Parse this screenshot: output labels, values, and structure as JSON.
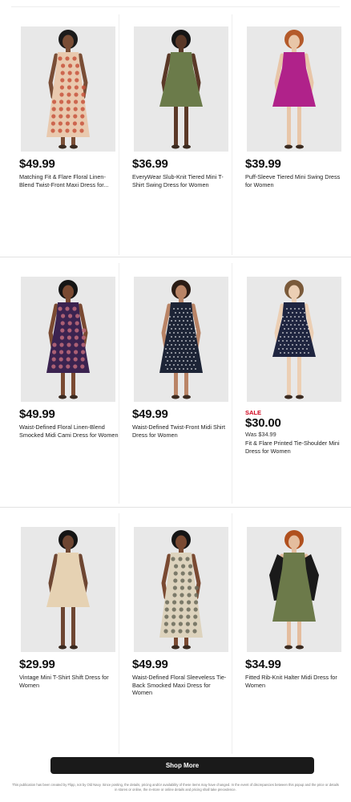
{
  "products": [
    {
      "price": "$49.99",
      "title": "Matching Fit & Flare Floral Linen-Blend Twist-Front Maxi Dress for...",
      "dress_color": "#e9c9ae",
      "accent": "#c8553d",
      "pattern": "floral",
      "skin": "#7a4e36",
      "hair": "#1b1b1b"
    },
    {
      "price": "$36.99",
      "title": "EveryWear Slub-Knit Tiered Mini T-Shirt Swing Dress for Women",
      "dress_color": "#6b7b4a",
      "accent": "#6b7b4a",
      "pattern": "solid",
      "skin": "#5a3827",
      "hair": "#151515"
    },
    {
      "price": "$39.99",
      "title": "Puff-Sleeve Tiered Mini Swing Dress for Women",
      "dress_color": "#b0228a",
      "accent": "#b0228a",
      "pattern": "solid",
      "skin": "#e8c6a8",
      "hair": "#b45a2a"
    },
    {
      "price": "$49.99",
      "title": "Waist-Defined Floral Linen-Blend Smocked Midi Cami Dress for Women",
      "dress_color": "#3b2350",
      "accent": "#c06a7a",
      "pattern": "floral",
      "skin": "#7a4a32",
      "hair": "#151515"
    },
    {
      "price": "$49.99",
      "title": "Waist-Defined Twist-Front Midi Shirt Dress for Women",
      "dress_color": "#1d2436",
      "accent": "#ffffff",
      "pattern": "dots",
      "skin": "#b98466",
      "hair": "#2a1b14"
    },
    {
      "sale_label": "SALE",
      "price": "$30.00",
      "was": "Was $34.99",
      "title": "Fit & Flare Printed Tie-Shoulder Mini Dress for Women",
      "dress_color": "#1f2540",
      "accent": "#ffffff",
      "pattern": "dots",
      "skin": "#eccfb4",
      "hair": "#7a5a3a"
    },
    {
      "price": "$29.99",
      "title": "Vintage Mini T-Shirt Shift Dress for Women",
      "dress_color": "#e6d2b3",
      "accent": "#e6d2b3",
      "pattern": "solid",
      "skin": "#6e4632",
      "hair": "#151515"
    },
    {
      "price": "$49.99",
      "title": "Waist-Defined Floral Sleeveless Tie-Back Smocked Maxi Dress for Women",
      "dress_color": "#ddd3bd",
      "accent": "#6a6a5a",
      "pattern": "floral",
      "skin": "#7a4a32",
      "hair": "#151515"
    },
    {
      "price": "$34.99",
      "title": "Fitted Rib-Knit Halter Midi Dress for Women",
      "dress_color": "#6c7a4a",
      "accent": "#1a1a1a",
      "pattern": "jacket",
      "skin": "#e4bd9e",
      "hair": "#b0501e"
    }
  ],
  "shop_more_label": "Shop More",
  "disclaimer": "This publication has been created by Flipp, not by Old Navy. Since posting, the details, pricing and/or availability of these items may have changed. In the event of discrepancies between this popup and the price or details in stores or online, the in-store or online details and pricing shall take precedence."
}
